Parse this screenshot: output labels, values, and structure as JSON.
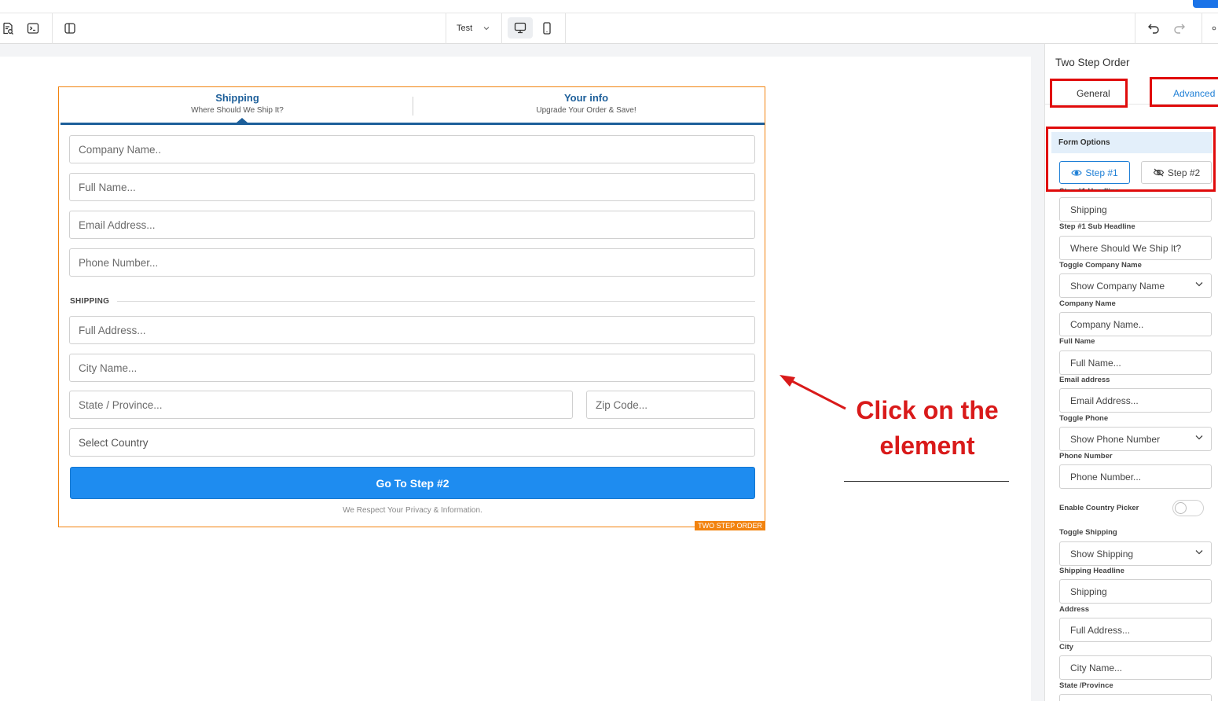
{
  "toolbar": {
    "page_select": "Test"
  },
  "form": {
    "tab1_title": "Shipping",
    "tab1_sub": "Where Should We Ship It?",
    "tab2_title": "Your info",
    "tab2_sub": "Upgrade Your Order & Save!",
    "company": "Company Name..",
    "full_name": "Full Name...",
    "email": "Email Address...",
    "phone": "Phone Number...",
    "shipping_label": "SHIPPING",
    "address": "Full Address...",
    "city": "City Name...",
    "state": "State / Province...",
    "zip": "Zip Code...",
    "country": "Select Country",
    "button": "Go To Step #2",
    "privacy": "We Respect Your Privacy & Information.",
    "element_tag": "TWO STEP ORDER"
  },
  "annotation": {
    "line1": "Click on the",
    "line2": "element",
    "color": "#d91a1a"
  },
  "panel": {
    "title": "Two Step Order",
    "tab_general": "General",
    "tab_advanced": "Advanced",
    "form_options": "Form Options",
    "step1": "Step #1",
    "step2": "Step #2",
    "label_headline_cut": "Step #1 Headline",
    "headline": "Shipping",
    "label_subheadline": "Step #1 Sub Headline",
    "subheadline": "Where Should We Ship It?",
    "label_toggle_company": "Toggle Company Name",
    "toggle_company": "Show Company Name",
    "label_company": "Company Name",
    "company": "Company Name..",
    "label_full_name": "Full Name",
    "full_name": "Full Name...",
    "label_email": "Email address",
    "email": "Email Address...",
    "label_toggle_phone": "Toggle Phone",
    "toggle_phone": "Show Phone Number",
    "label_phone": "Phone Number",
    "phone": "Phone Number...",
    "label_country_picker": "Enable Country Picker",
    "country_picker_enabled": false,
    "label_toggle_shipping": "Toggle Shipping",
    "toggle_shipping": "Show Shipping",
    "label_shipping_headline": "Shipping Headline",
    "shipping_headline": "Shipping",
    "label_address": "Address",
    "address": "Full Address...",
    "label_city": "City",
    "city": "City Name...",
    "label_state": "State /Province"
  },
  "colors": {
    "accent": "#1e8cf0",
    "highlight": "#e00b0b",
    "element_outline": "#f2830f",
    "tab_title": "#1d5f9a"
  }
}
